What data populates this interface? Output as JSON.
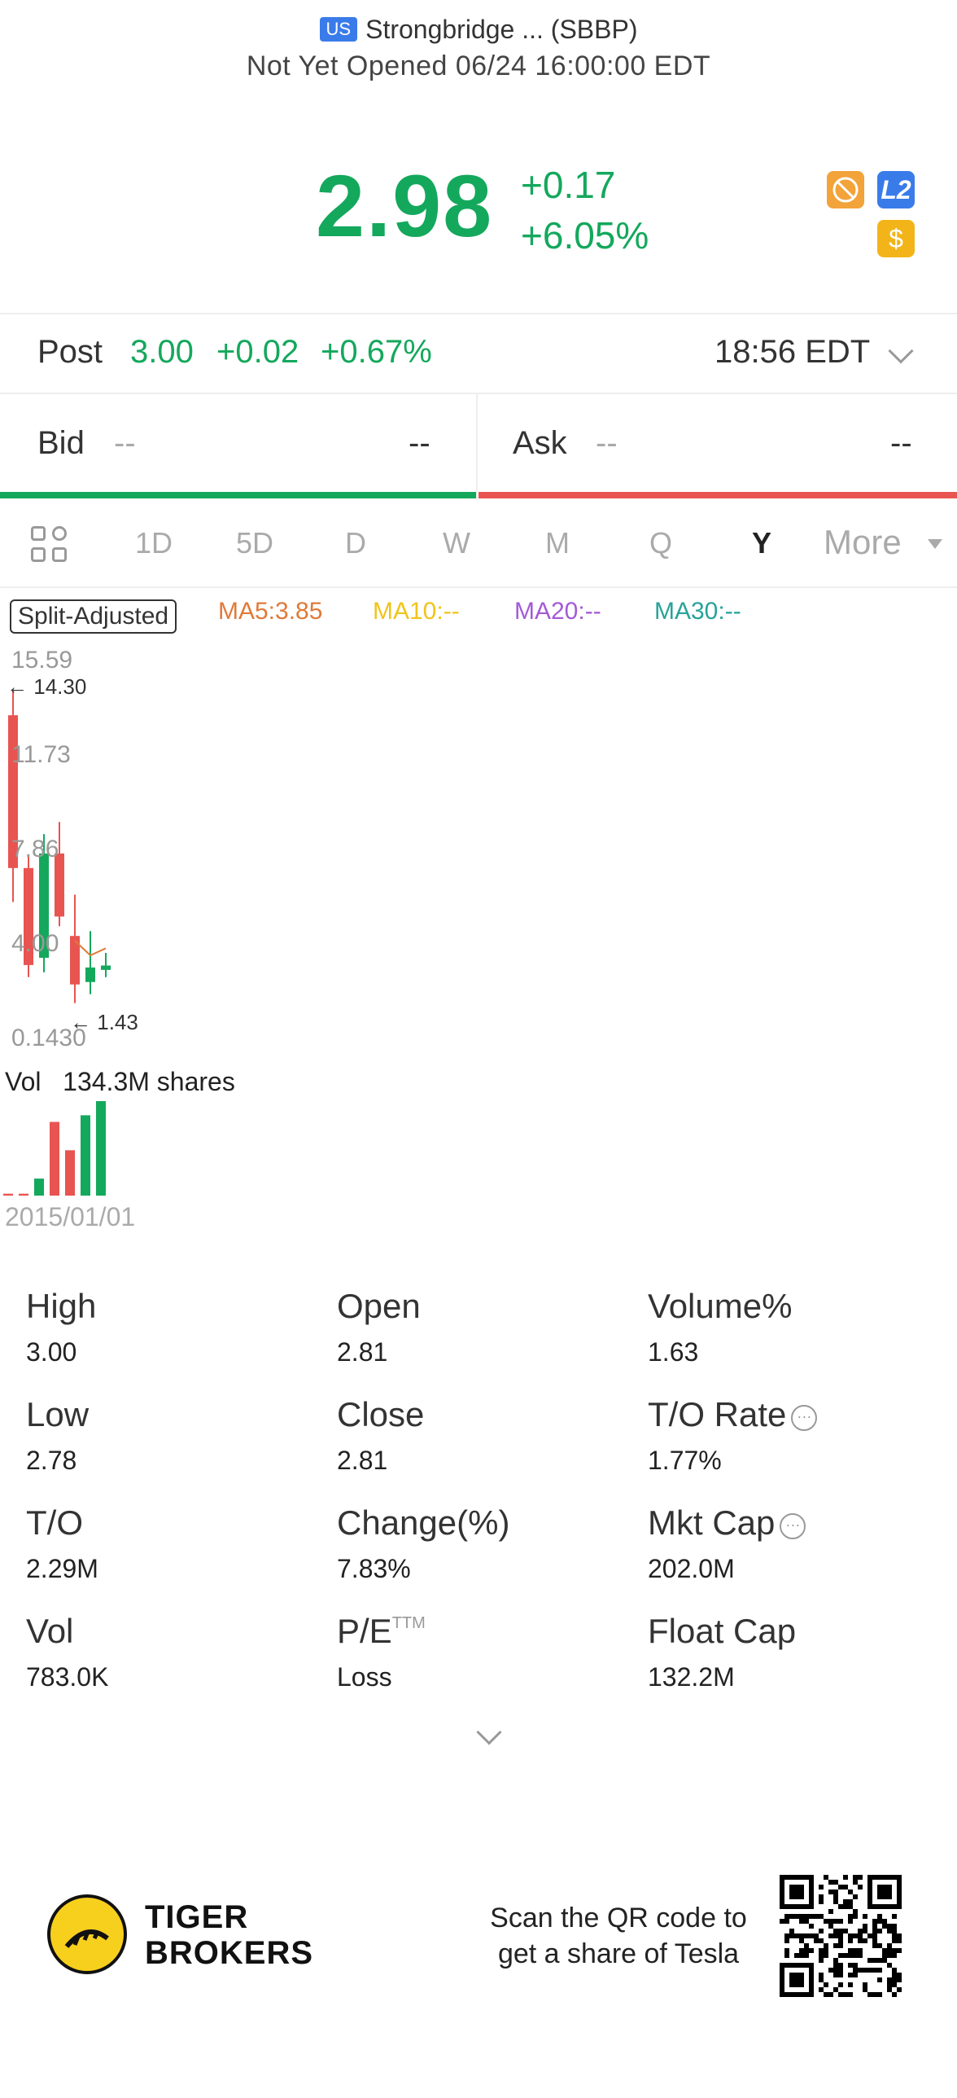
{
  "header": {
    "market_badge": "US",
    "name": "Strongbridge ... (SBBP)",
    "status": "Not Yet Opened 06/24 16:00:00 EDT"
  },
  "quote": {
    "price": "2.98",
    "change": "+0.17",
    "change_pct": "+6.05%",
    "badges": {
      "l2": "L2",
      "currency": "$"
    }
  },
  "post_market": {
    "label": "Post",
    "price": "3.00",
    "change": "+0.02",
    "change_pct": "+0.67%",
    "time": "18:56 EDT"
  },
  "bid_ask": {
    "bid_label": "Bid",
    "bid_price": "--",
    "bid_size": "--",
    "ask_label": "Ask",
    "ask_price": "--",
    "ask_size": "--"
  },
  "periods": {
    "tabs": [
      "1D",
      "5D",
      "D",
      "W",
      "M",
      "Q",
      "Y"
    ],
    "active": "Y",
    "more": "More"
  },
  "indicators": {
    "split": "Split-Adjusted",
    "ma5": "MA5:3.85",
    "ma10": "MA10:--",
    "ma20": "MA20:--",
    "ma30": "MA30:--"
  },
  "chart": {
    "y_labels": [
      "15.59",
      "11.73",
      "7.86",
      "4.00",
      "0.1430"
    ],
    "high_marker": "14.30",
    "low_marker": "1.43",
    "volume_label": "Vol",
    "volume_value": "134.3M shares",
    "date_label": "2015/01/01"
  },
  "colors": {
    "up": "#14a85c",
    "down": "#e85450",
    "ma5": "#e07a38",
    "ma10": "#f0c419",
    "ma20": "#a45ad6",
    "ma30": "#27a39a"
  },
  "chart_data": {
    "type": "candlestick",
    "x_first": "2015/01/01",
    "ylim": [
      0.143,
      15.59
    ],
    "ohlc": [
      {
        "open": 13.3,
        "high": 14.3,
        "low": 5.6,
        "close": 7.0
      },
      {
        "open": 7.0,
        "high": 7.5,
        "low": 2.5,
        "close": 3.0
      },
      {
        "open": 3.3,
        "high": 8.4,
        "low": 2.7,
        "close": 7.6
      },
      {
        "open": 7.6,
        "high": 8.9,
        "low": 4.6,
        "close": 5.0
      },
      {
        "open": 4.2,
        "high": 5.9,
        "low": 1.43,
        "close": 2.2
      },
      {
        "open": 2.3,
        "high": 4.4,
        "low": 1.8,
        "close": 2.9
      },
      {
        "open": 2.8,
        "high": 3.5,
        "low": 2.5,
        "close": 2.98
      }
    ],
    "volume_relative": [
      0.02,
      0.02,
      0.18,
      0.78,
      0.48,
      0.85,
      1.0
    ]
  },
  "stats": [
    {
      "label": "High",
      "value": "3.00"
    },
    {
      "label": "Open",
      "value": "2.81"
    },
    {
      "label": "Volume%",
      "value": "1.63"
    },
    {
      "label": "Low",
      "value": "2.78"
    },
    {
      "label": "Close",
      "value": "2.81"
    },
    {
      "label": "T/O Rate",
      "value": "1.77%"
    },
    {
      "label": "T/O",
      "value": "2.29M"
    },
    {
      "label": "Change(%)",
      "value": "7.83%"
    },
    {
      "label": "Mkt Cap",
      "value": "202.0M"
    },
    {
      "label": "Vol",
      "value": "783.0K"
    },
    {
      "label": "P/E",
      "value": "Loss",
      "sup": "TTM"
    },
    {
      "label": "Float Cap",
      "value": "132.2M"
    }
  ],
  "footer": {
    "brand_line1": "TIGER",
    "brand_line2": "BROKERS",
    "scan_line1": "Scan the QR code to",
    "scan_line2": "get a share of Tesla"
  }
}
